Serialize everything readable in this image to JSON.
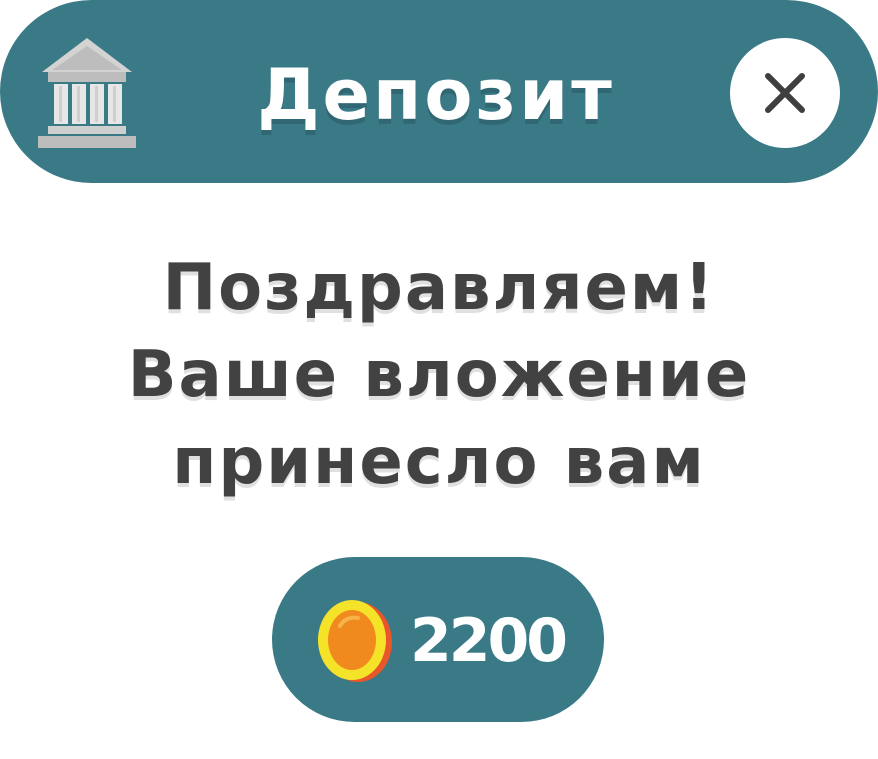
{
  "header": {
    "title": "Депозит",
    "icon": "bank-icon",
    "close_icon": "close-icon",
    "background_color": "#3a7a87"
  },
  "message": {
    "lines": [
      "Поздравляем!",
      "Ваше вложение",
      "принесло вам"
    ],
    "text_color": "#424242"
  },
  "reward": {
    "amount": "2200",
    "icon": "coin-icon",
    "background_color": "#3a7a87"
  }
}
